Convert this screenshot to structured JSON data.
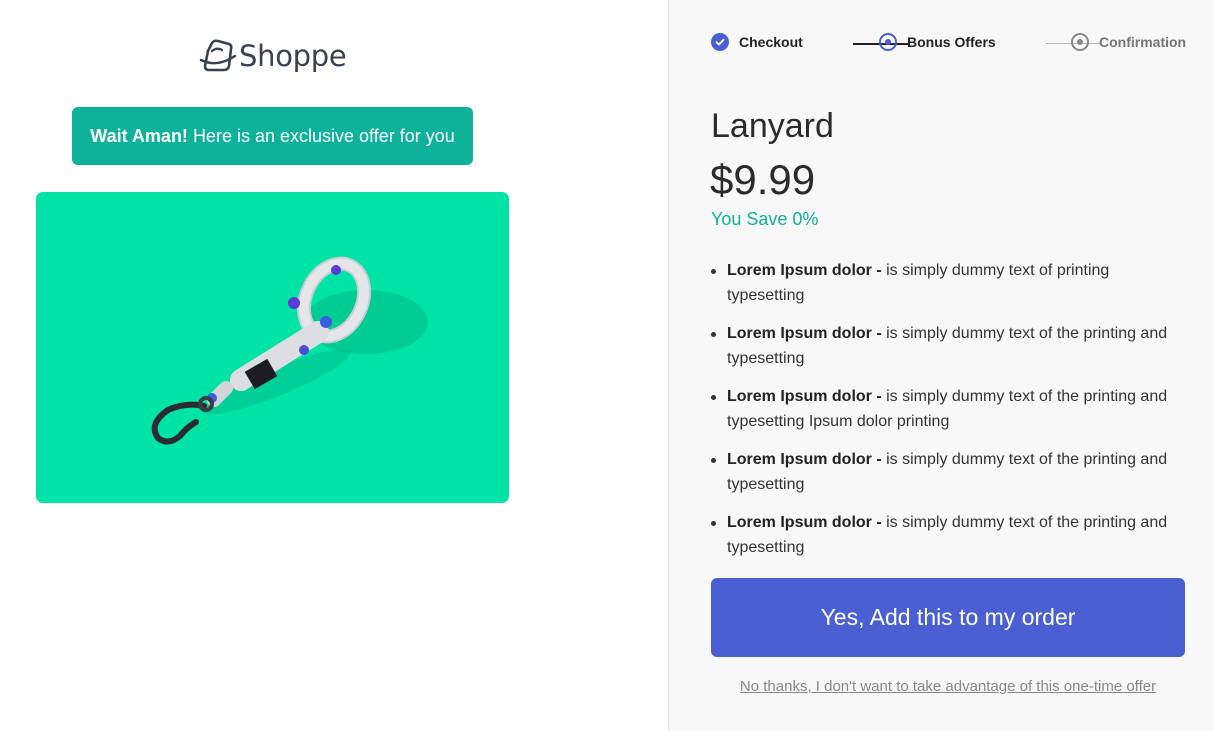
{
  "brand": {
    "name": "Shoppe",
    "icon": "shopping-bag-icon"
  },
  "offer_banner": {
    "name": "Wait Aman!",
    "message": "Here is an exclusive offer for you"
  },
  "product_image": {
    "background": "#00e3a6",
    "depicts": "lanyard-image"
  },
  "steps": [
    {
      "label": "Checkout",
      "state": "complete"
    },
    {
      "label": "Bonus Offers",
      "state": "current"
    },
    {
      "label": "Confirmation",
      "state": "upcoming"
    }
  ],
  "product": {
    "title": "Lanyard",
    "price": "$9.99",
    "savings": "You Save 0%"
  },
  "features": [
    {
      "bold": "Lorem Ipsum dolor -",
      "text": " is simply dummy text of printing typesetting"
    },
    {
      "bold": "Lorem Ipsum dolor -",
      "text": " is simply dummy text of the printing and typesetting"
    },
    {
      "bold": "Lorem Ipsum dolor -",
      "text": " is simply dummy text of the printing and typesetting Ipsum dolor printing"
    },
    {
      "bold": "Lorem Ipsum dolor -",
      "text": " is simply dummy text of the printing and typesetting"
    },
    {
      "bold": "Lorem Ipsum dolor -",
      "text": " is simply dummy text of the printing and typesetting"
    }
  ],
  "cta": {
    "label": "Yes, Add this to my order"
  },
  "decline": {
    "label": "No thanks, I don't want to take advantage of this one-time offer"
  },
  "colors": {
    "accent": "#4a5fd1",
    "teal": "#0eb29a",
    "image_bg": "#00e3a6"
  }
}
